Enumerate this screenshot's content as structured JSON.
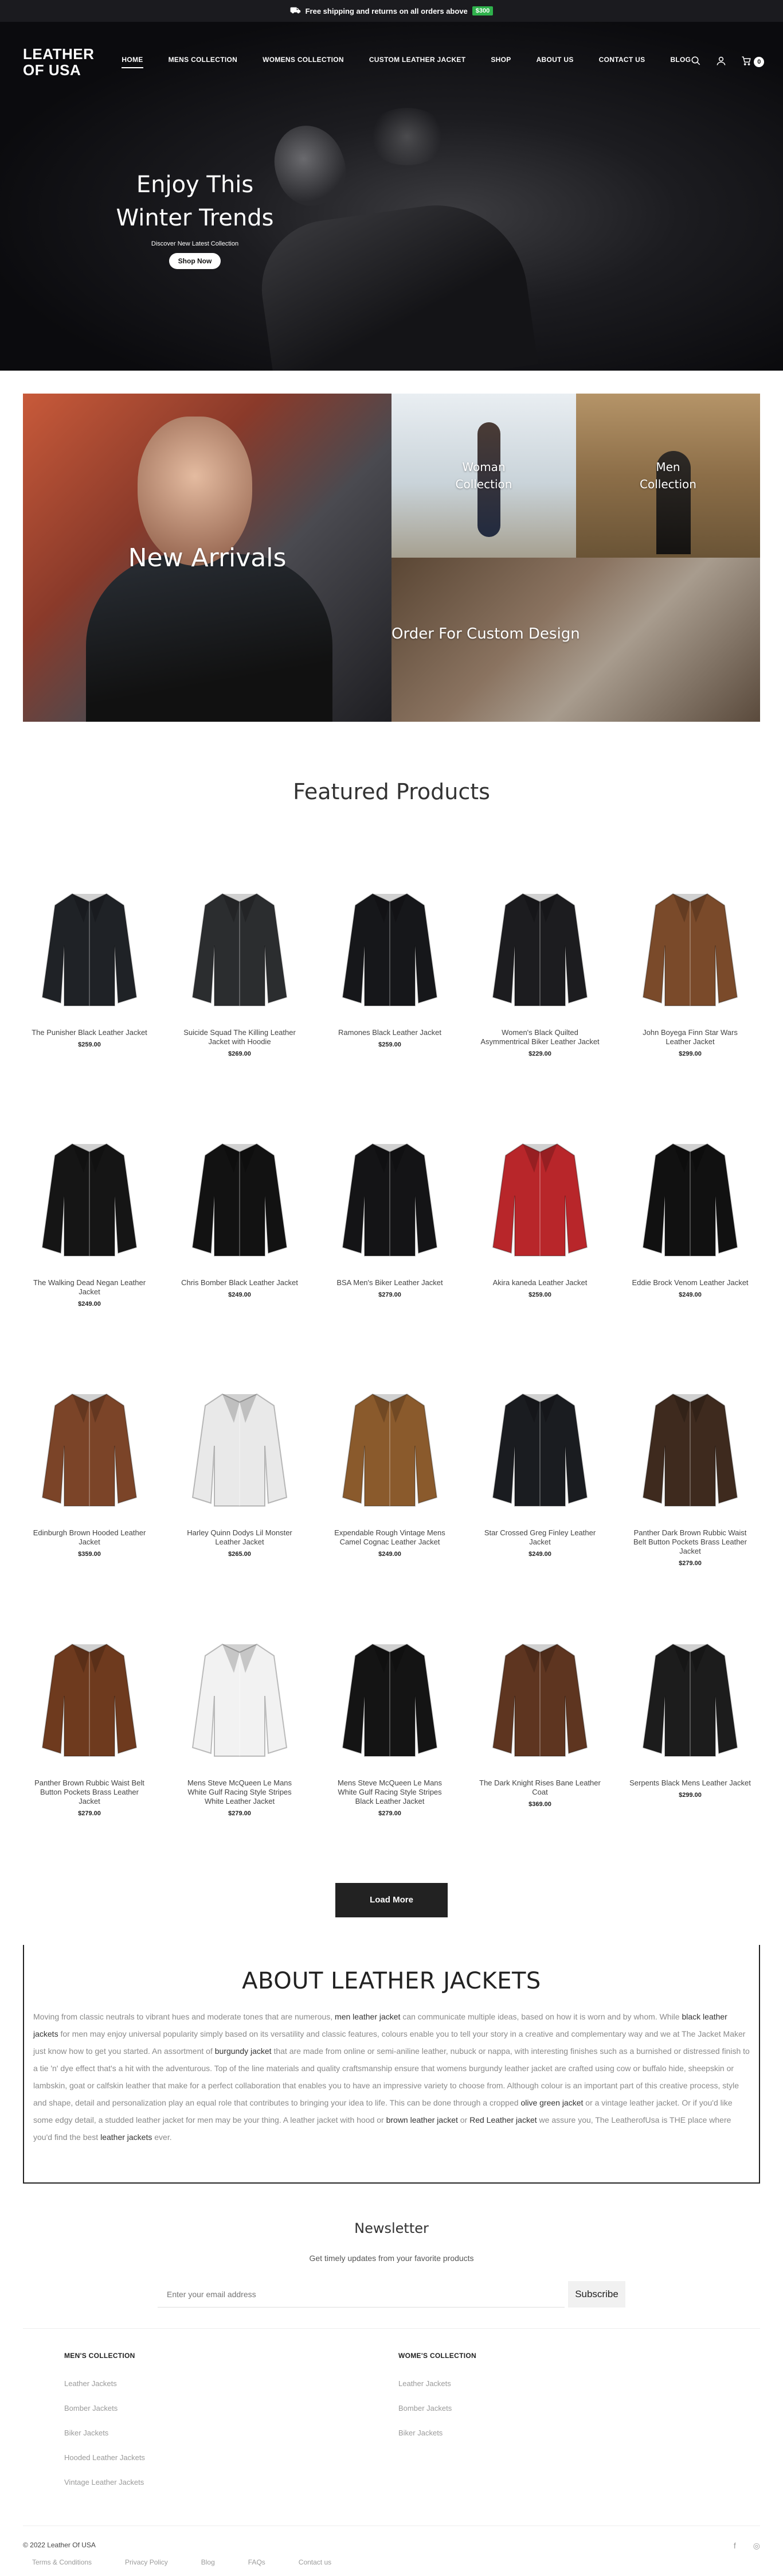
{
  "announcement": {
    "text": "Free shipping and returns on all orders above",
    "badge": "$300"
  },
  "header": {
    "logo_line1": "LEATHER",
    "logo_line2": "OF USA",
    "nav": [
      "HOME",
      "MENS COLLECTION",
      "WOMENS COLLECTION",
      "CUSTOM LEATHER JACKET",
      "SHOP",
      "ABOUT US",
      "CONTACT US",
      "BLOG"
    ],
    "cart_count": "0"
  },
  "hero": {
    "title_line1": "Enjoy This",
    "title_line2": "Winter Trends",
    "subtitle": "Discover New Latest Collection",
    "button": "Shop Now"
  },
  "categories": {
    "new_arrivals": "New Arrivals",
    "women_line1": "Woman",
    "women_line2": "Collection",
    "men_line1": "Men",
    "men_line2": "Collection",
    "custom": "Order For Custom Design"
  },
  "featured": {
    "title": "Featured Products",
    "products": [
      {
        "name": "The Punisher Black Leather Jacket",
        "price": "$259.00",
        "color": "#1f2226"
      },
      {
        "name": "Suicide Squad The Killing Leather Jacket with Hoodie",
        "price": "$269.00",
        "color": "#2b2d2f"
      },
      {
        "name": "Ramones Black Leather Jacket",
        "price": "$259.00",
        "color": "#16171a"
      },
      {
        "name": "Women's Black Quilted Asymmentrical Biker Leather Jacket",
        "price": "$229.00",
        "color": "#1c1c1f"
      },
      {
        "name": "John Boyega Finn Star Wars Leather Jacket",
        "price": "$299.00",
        "color": "#7a4a2a"
      },
      {
        "name": "The Walking Dead Negan Leather Jacket",
        "price": "$249.00",
        "color": "#151515"
      },
      {
        "name": "Chris Bomber Black Leather Jacket",
        "price": "$249.00",
        "color": "#121212"
      },
      {
        "name": "BSA Men's Biker Leather Jacket",
        "price": "$279.00",
        "color": "#141416"
      },
      {
        "name": "Akira kaneda Leather Jacket",
        "price": "$259.00",
        "color": "#b8262a"
      },
      {
        "name": "Eddie Brock Venom Leather Jacket",
        "price": "$249.00",
        "color": "#111111"
      },
      {
        "name": "Edinburgh Brown Hooded Leather Jacket",
        "price": "$359.00",
        "color": "#7b4428"
      },
      {
        "name": "Harley Quinn Dodys Lil Monster Leather Jacket",
        "price": "$265.00",
        "color": "#e9e9e9"
      },
      {
        "name": "Expendable Rough Vintage Mens Camel Cognac Leather Jacket",
        "price": "$249.00",
        "color": "#8a5a2c"
      },
      {
        "name": "Star Crossed Greg Finley Leather Jacket",
        "price": "$249.00",
        "color": "#1a1c20"
      },
      {
        "name": "Panther Dark Brown Rubbic Waist Belt Button Pockets Brass Leather Jacket",
        "price": "$279.00",
        "color": "#3e2a1e"
      },
      {
        "name": "Panther Brown Rubbic Waist Belt Button Pockets Brass Leather Jacket",
        "price": "$279.00",
        "color": "#6e3a1e"
      },
      {
        "name": "Mens Steve McQueen Le Mans White Gulf Racing Style Stripes White Leather Jacket",
        "price": "$279.00",
        "color": "#f2f2f2"
      },
      {
        "name": "Mens Steve McQueen Le Mans White Gulf Racing Style Stripes Black Leather Jacket",
        "price": "$279.00",
        "color": "#141414"
      },
      {
        "name": "The Dark Knight Rises Bane Leather Coat",
        "price": "$369.00",
        "color": "#5e3520"
      },
      {
        "name": "Serpents Black Mens Leather Jacket",
        "price": "$299.00",
        "color": "#1c1c1c"
      }
    ],
    "load_more": "Load More"
  },
  "about": {
    "title": "ABOUT LEATHER JACKETS",
    "p1": "Moving from classic neutrals to vibrant hues and moderate tones that are numerous, ",
    "k1": "men leather jacket",
    "p2": " can communicate multiple ideas, based on how it is worn and by whom. While ",
    "k2": "black leather jackets",
    "p3": " for men may enjoy universal popularity simply based on its versatility and classic features, colours enable you to tell your story in a creative and complementary way and we at The Jacket Maker just know how to get you started. An assortment of ",
    "k3": "burgundy jacket",
    "p4": " that are made from online or semi-aniline leather, nubuck or nappa, with interesting finishes such as a burnished or distressed finish to a tie 'n' dye effect that's a hit with the adventurous. Top of the line materials and quality craftsmanship ensure that womens burgundy leather jacket are crafted using cow or buffalo hide, sheepskin or lambskin, goat or calfskin leather that make for a perfect collaboration that enables you to have an impressive variety to choose from. Although colour is an important part of this creative process, style and shape, detail and personalization play an equal role that contributes to bringing your idea to life. This can be done through a cropped ",
    "k4": "olive green jacket",
    "p5": " or a vintage leather jacket. Or if you'd like some edgy detail, a studded leather jacket for men may be your thing. A leather jacket with hood or ",
    "k5": "brown leather jacket",
    "p6": " or ",
    "k6": "Red Leather jacket",
    "p7": " we assure you, The LeatherofUsa is THE place where you'd find the best ",
    "k7": "leather jackets",
    "p8": " ever."
  },
  "newsletter": {
    "title": "Newsletter",
    "subtitle": "Get timely updates from your favorite products",
    "placeholder": "Enter your email address",
    "button": "Subscribe"
  },
  "footer": {
    "men_title": "MEN'S COLLECTION",
    "men_links": [
      "Leather Jackets",
      "Bomber Jackets",
      "Biker Jackets",
      "Hooded Leather Jackets",
      "Vintage Leather Jackets"
    ],
    "women_title": "WOME'S COLLECTION",
    "women_links": [
      "Leather Jackets",
      "Bomber Jackets",
      "Biker Jackets"
    ],
    "copyright": "© 2022 Leather Of USA",
    "bottom_links": [
      "Terms & Conditions",
      "Privacy Policy",
      "Blog",
      "FAQs",
      "Contact us"
    ],
    "social_facebook": "f",
    "social_instagram": "◎"
  }
}
